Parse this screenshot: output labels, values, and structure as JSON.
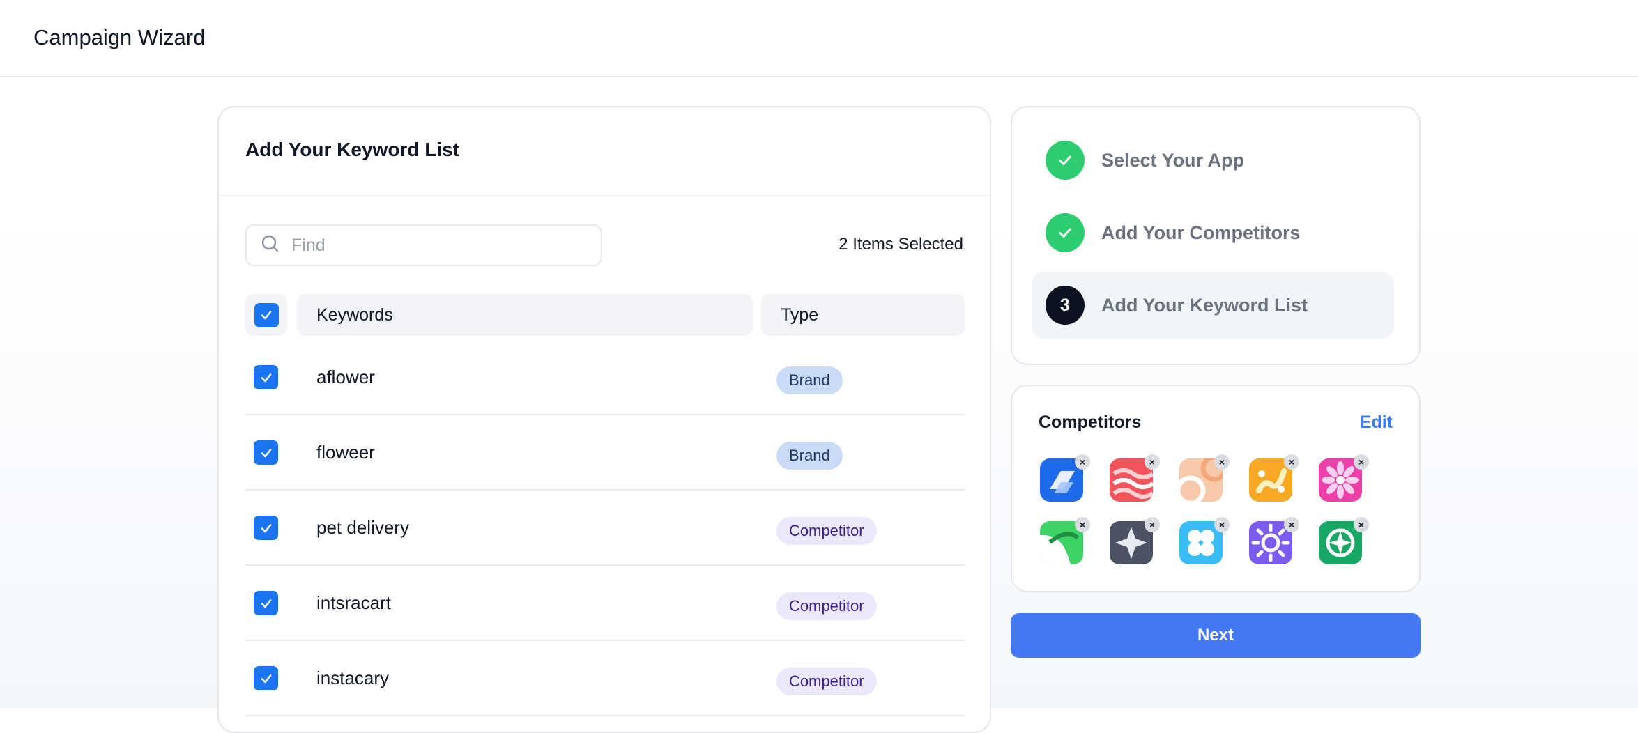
{
  "header": {
    "title": "Campaign Wizard"
  },
  "keyword_panel": {
    "title": "Add Your Keyword List",
    "search_placeholder": "Find",
    "search_value": "",
    "selected_count": "2 Items Selected",
    "columns": {
      "keywords": "Keywords",
      "type": "Type"
    },
    "rows": [
      {
        "keyword": "aflower",
        "type": "Brand",
        "checked": true
      },
      {
        "keyword": "floweer",
        "type": "Brand",
        "checked": true
      },
      {
        "keyword": "pet delivery",
        "type": "Competitor",
        "checked": true
      },
      {
        "keyword": "intsracart",
        "type": "Competitor",
        "checked": true
      },
      {
        "keyword": "instacary",
        "type": "Competitor",
        "checked": true
      }
    ]
  },
  "steps": [
    {
      "number": "1",
      "label": "Select Your App",
      "status": "done"
    },
    {
      "number": "2",
      "label": "Add Your Competitors",
      "status": "done"
    },
    {
      "number": "3",
      "label": "Add Your Keyword List",
      "status": "current"
    }
  ],
  "competitors": {
    "title": "Competitors",
    "edit_label": "Edit",
    "remove_glyph": "×",
    "apps": [
      {
        "icon": "blue-parallelogram-app-icon",
        "color": "#1f6ae8"
      },
      {
        "icon": "red-waves-app-icon",
        "color": "#f2545b"
      },
      {
        "icon": "peach-swirl-app-icon",
        "color": "#f7c9a8"
      },
      {
        "icon": "orange-chain-app-icon",
        "color": "#f8a824"
      },
      {
        "icon": "pink-flower-app-icon",
        "color": "#ec3fa9"
      },
      {
        "icon": "green-leaf-app-icon",
        "color": "#3fd267"
      },
      {
        "icon": "gray-star-app-icon",
        "color": "#4a5263"
      },
      {
        "icon": "cyan-clover-app-icon",
        "color": "#38bdf8"
      },
      {
        "icon": "purple-sun-app-icon",
        "color": "#7c5cf0"
      },
      {
        "icon": "green-compass-app-icon",
        "color": "#17a865"
      }
    ]
  },
  "next_label": "Next",
  "colors": {
    "primary": "#1a76f0",
    "button": "#4479f5",
    "success": "#2ecc71",
    "brand_badge": "#c9dbf6",
    "competitor_badge": "#ece8fc"
  }
}
